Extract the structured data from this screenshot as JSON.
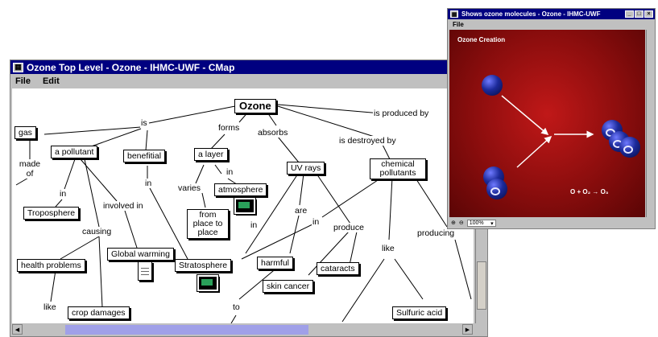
{
  "main_window": {
    "title": "Ozone Top Level - Ozone - IHMC-UWF - CMap",
    "menu": [
      "File",
      "Edit"
    ]
  },
  "concept_map": {
    "concepts": {
      "ozone": "Ozone",
      "gas": "gas",
      "pollutant": "a pollutant",
      "benefitial": "benefitial",
      "layer": "a layer",
      "uv_rays": "UV rays",
      "chemical_pollutants": "chemical pollutants",
      "atmosphere": "atmosphere",
      "troposphere": "Troposphere",
      "from_place": "from place to place",
      "health_problems": "health problems",
      "global_warming": "Global warming",
      "stratosphere": "Stratosphere",
      "harmful": "harmful",
      "cataracts": "cataracts",
      "skin_cancer": "skin cancer",
      "crop_damages": "crop damages",
      "sulfuric_acid": "Sulfuric acid"
    },
    "link_labels": {
      "is": "is",
      "forms": "forms",
      "absorbs": "absorbs",
      "is_destroyed_by": "is destroyed by",
      "is_produced_by": "is produced by",
      "made_of": "made of",
      "in_trop": "in",
      "in_benef": "in",
      "in_atm": "in",
      "varies": "varies",
      "involved_in": "involved in",
      "causing": "causing",
      "are": "are",
      "in_chem": "in",
      "produce": "produce",
      "in_strat": "in",
      "like": "like",
      "like2": "like",
      "producing": "producing",
      "to": "to"
    }
  },
  "molecule_window": {
    "title": "Shows ozone molecules - Ozone - IHMC-UWF",
    "menu": [
      "File"
    ],
    "heading": "Ozone Creation",
    "equation": "O + O₂ → O₃",
    "zoom": "100%"
  },
  "colors": {
    "titlebar": "#000080",
    "window_chrome": "#c0c0c0",
    "molecule_bg": "#a01010",
    "atom": "#1c2a9a",
    "image_thumb": "#2aa05a"
  }
}
